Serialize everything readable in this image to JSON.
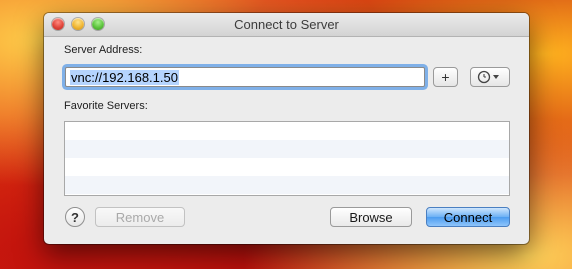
{
  "window": {
    "title": "Connect to Server"
  },
  "server_address": {
    "label": "Server Address:",
    "value": "vnc://192.168.1.50"
  },
  "favorites": {
    "label": "Favorite Servers:"
  },
  "icons": {
    "add": "plus-icon",
    "recent": "clock-icon",
    "dropdown": "chevron-down-icon",
    "help": "question-mark-icon"
  },
  "buttons": {
    "add_label": "+",
    "help_label": "?",
    "remove_label": "Remove",
    "browse_label": "Browse",
    "connect_label": "Connect"
  },
  "colors": {
    "focus_ring": "#7fb0e8",
    "selection": "#b5d4fe",
    "default_button": "#4c9cf0"
  }
}
